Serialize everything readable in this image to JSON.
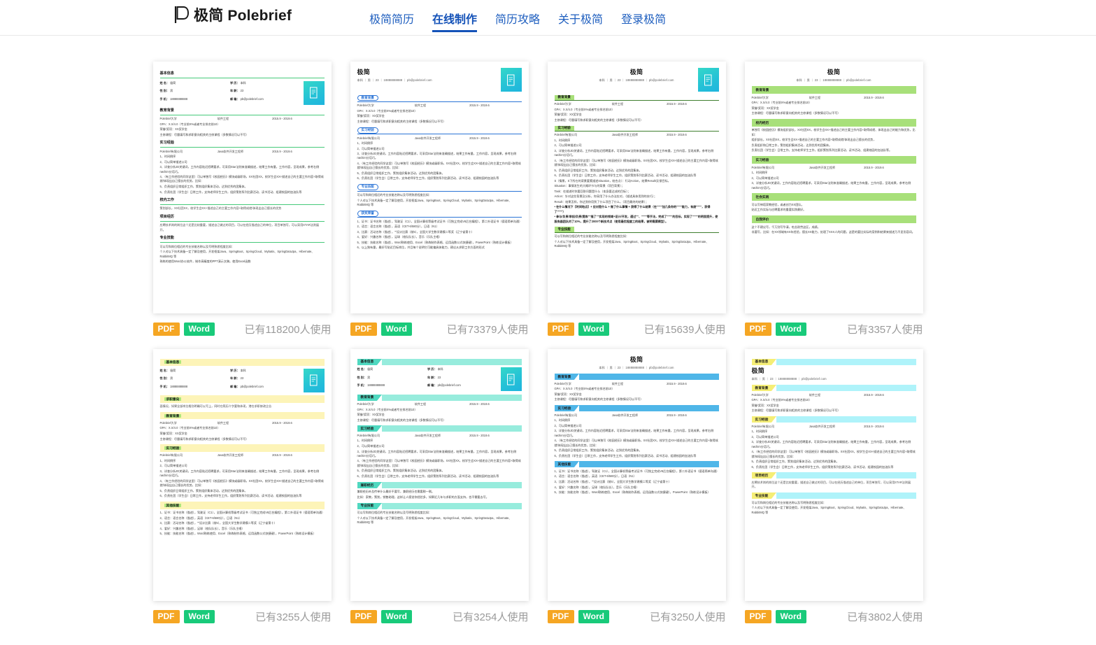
{
  "header": {
    "brand_text": "极简 Polebrief",
    "brand_icon": "polebrief-logo-icon",
    "nav": [
      {
        "label": "极简简历",
        "active": false
      },
      {
        "label": "在线制作",
        "active": true
      },
      {
        "label": "简历攻略",
        "active": false
      },
      {
        "label": "关于极简",
        "active": false
      },
      {
        "label": "登录极简",
        "active": false
      }
    ]
  },
  "common": {
    "pdf_label": "PDF",
    "word_label": "Word",
    "basic": {
      "section": "基本信息",
      "name_key": "姓 名：",
      "name_val": "极简",
      "gender_key": "性 别：",
      "gender_val": "男",
      "phone_key": "手 机：",
      "phone_val": "18888888888",
      "edu_key": "学 历：",
      "edu_val": "本科",
      "age_key": "年 龄：",
      "age_val": "23",
      "mail_key": "邮 箱：",
      "mail_val": "pb@polebrief.com"
    },
    "name": "极简",
    "name_line": "本科 ｜ 男 ｜ 23 ｜ 18888888888 ｜ pb@polebrief.com",
    "edu": {
      "section": "教育背景",
      "school": "Polebrief大学",
      "major": "软件工程",
      "date": "2015.9 - 2019.6",
      "l1": "GPA：X.X/4.0（专业前X%或者专业排名前10）",
      "l2": "荣誉/奖项：XX奖学金",
      "l3": "主修课程：尽量填写和求职意向相关的主修课程（多数情况可以不写）"
    },
    "intern": {
      "section": "实习经验",
      "company": "Polebrief有限公司",
      "role": "Java软件开发工程师",
      "date": "2015.9 - 2019.6",
      "b1": "1、时间倒序",
      "b2": "2、可以简单描述公司",
      "b3": "3、详查分析JD关键词，工作内容贴近招聘要求，可采用Star法则来准确描述，结果工作有量，工作内容，呈现成果，参考右侧писhim分话巧。",
      "b4": "4、（有工作经验的同学这里）可以单独写《校园经历》模块或级职场，XX社团XX，校学生会XX+描述自己的主要工作内容+取得成就/体现出自己擅长的优势，比如：",
      "b5": "5、负责组织日常组织工作，策划组织集体活动，达到优秀的团集体。",
      "b6": "6、负责社团（学生会）日常工作，支持老师学生工作，组织策划系列比赛活动、读书活动、组建校园的加油队等"
    },
    "campus_work": {
      "section": "校内工作",
      "l1": "策划部长，XX社团XX，校学生会XX+描述自己的主要工作内容+取得成就/体现出自己擅长的优势"
    },
    "campus_exp": {
      "section": "校内经历",
      "l1": "单独写《校园经历》模块组织部长，XX社团XX，校学生会XX+描述自己的主要工作内容+取得成就、体现出自己的能力和优势，比如：",
      "l2": "组织部长，XX社团XX，校学生会XX+描述自己的主要工作内容+取得成就/体现出自己擅长的优势，",
      "l3": "负责组织和日常工作，策划组织集体活动，达到优秀的团集体。",
      "l4": "负责社团（学生会）日常工作，支持老师学生工作，组织策划系列比赛活动、读书活动、组建校园的加油队等。"
    },
    "project": {
      "section": "项目经历",
      "l1": "应聘技术岗的岗位这个还是比较重要，描述自己做过的项目，可以在经历描述自己的单位，项目单独写，可以采用STAR法则展开。"
    },
    "skill": {
      "section": "专业技能",
      "l1": "可以写和岗位相近的专业技能名称以及写明熟悉程度比如：",
      "l2": "个人对以下技术具备一定了解及使用，开发框架Java、SpringBoot、SpringCloud、Mybatis、SpringDataJpa、Hibernate、RabbitMQ 等",
      "l3": "熟练的使用Word办公软件，制作高精度的PPT演示文稿，使用Excel函数"
    },
    "other_skill": {
      "section": "其他技能",
      "b1": "1、证书：证书名称（描述），驾驶证（C1），全国计算机等级考试证书（可独立完成V8后台编程），第二外语证书（德语简单沟通）",
      "b2": "2、语言：语言名称（描述），英语（CET-6/580分），日语（N1）",
      "b3": "3、比赛：活动名称（描述），\"\"设计比赛（前5），全国大学生数学建模二等奖（辽宁省第十）",
      "b4": "4、爱好：兴趣名称（描述），足球（校队队长），音乐（乐队主唱）",
      "b5": "5、技能：技能名称（描述），Word熟练使用、Excel（熟练制作表格、运用函数公式快捷键），PowerPoint（熟练设计模板）",
      "b6": "6、以上独有量，最好写贴近目标岗位，并且每个说明它可能偏具体能力，建议从求职工作方面的形式"
    },
    "honor": {
      "section": "获奖荣誉",
      "b1": "1、证书：证书名称（描述），驾驶证（C1），全国计算机等级考试证书（可独立完成V8后台编程），第二外语证书（德语简单沟通）",
      "b2": "2、语言：语言名称（描述），英语（CET-6/580分），日语（N1）",
      "b3": "3、比赛：活动名称（描述），\"\"设计比赛（前5），全国大学生数学建模二等奖（辽宁省第十）",
      "b4": "4、爱好：兴趣名称（描述），足球（校队队长），音乐（乐队主唱）",
      "b5": "5、技能：技能名称（描述），Word熟练使用、Excel（熟练制作表格、运用函数公式快捷键），PowerPoint（熟练设计模板）",
      "b6": "6、以上独有量，最好写贴近目标岗位，并且每个说明它可能偏具体能力，建议从求职工作方面的形式"
    },
    "star": {
      "s": "S（情景，S下所在的背景要素描述Situation，结合点）：行动Action，结果Result/反馈目标，",
      "t": "Situation：事情发生的大概环节与的背景（项目背景）；",
      "task": "Task：在描述时你要回答问题是什么（本身要达成的目标）；",
      "action": "Action：针对这些背景及分析，你采用了什么办法应对，（描述具体用到的技巧）；",
      "result": "Result：结果怎样，你达到你用到了什么项目了什么，（项目最终的结果）；",
      "b1": "• 在什么情况下【时间地点】+ 应对是什么 + 做了什么事情 + 获得了什么结果（在\"\"\"\"加几条你的\"\"\"\"能力，有废\"\"\"\"，获得了\"\"\"\"）",
      "b2": "• 参与/负责/承担/负责/提炼\"\"描了\"\"实现的领域+设计/开发，通过\"\"、\"\"\"\"等手法，完成了\"\"\"\"的目标，实现了\"\"\"\"的明显提升，使服务器团队约了10%，提升了2000个新技术点（使用最优程度工的结果，被明需要模型）。"
    },
    "job_intent": {
      "section": "求职意向",
      "l1": "面情况，如果全部岗位格别明确可以写上，同时在简历介字要和体现，港在求职修改企业."
    },
    "parttime": {
      "section": "兼职经历",
      "l1": "兼职经历补及传单什么最好不要写，兼职经历也需要剔一剔。",
      "l2": "比如：家教，策划，销售助理，这样让人感觉你经验多，如果近几年与求职的方面支持，也不需要去写。"
    },
    "social": {
      "section": "社会实践",
      "l1": "可以写神塔家教经验，或者创力XX团队。",
      "l2": "贴近工作实际与应聘要求的重要实践最好。"
    },
    "self_eval": {
      "section": "自我评价",
      "l1": "这个不建议写，千万别写华清，吃苦耐劳这区，成绩。",
      "l2": "非要写，比如：在XX领域有XX年经验，擅长XX能力，处理了XXX人的问题，这是的要比实际的案例和结果来描述乃不显形容词。"
    }
  },
  "templates": [
    {
      "id": "tpl-1",
      "style": "green-underline",
      "use_count": "已有118200人使用"
    },
    {
      "id": "tpl-2",
      "style": "blue-pill",
      "use_count": "已有73379人使用"
    },
    {
      "id": "tpl-3",
      "style": "green-tag",
      "use_count": "已有15639人使用"
    },
    {
      "id": "tpl-4",
      "style": "green-band",
      "use_count": "已有3357人使用"
    },
    {
      "id": "tpl-5",
      "style": "yellow-band",
      "use_count": "已有3255人使用"
    },
    {
      "id": "tpl-6",
      "style": "teal-arrow",
      "use_count": "已有3254人使用"
    },
    {
      "id": "tpl-7",
      "style": "blue-arrow",
      "use_count": "已有3250人使用"
    },
    {
      "id": "tpl-8",
      "style": "yellow-arrow",
      "use_count": "已有3802人使用"
    }
  ],
  "colors": {
    "nav_active": "#1452b8",
    "pdf_badge": "#f5a623",
    "word_badge": "#19ca7a",
    "green_accent": "#a8e07a",
    "blue_accent": "#4fb6e8",
    "teal_accent": "#4fd8c0",
    "yellow_accent": "#f5ee76",
    "use_count_text": "#9a9a9a"
  }
}
